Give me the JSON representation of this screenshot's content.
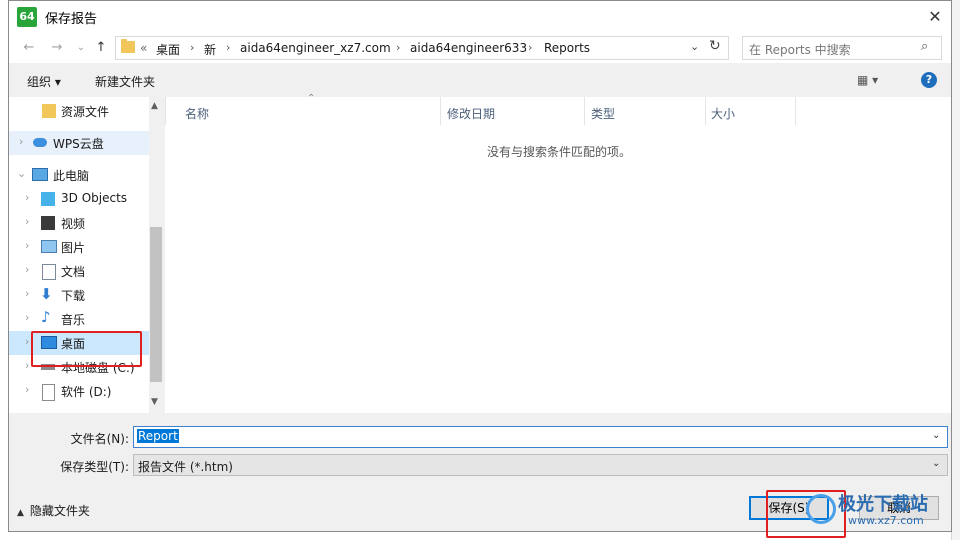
{
  "window": {
    "app_icon_text": "64",
    "title": "保存报告",
    "close_glyph": "✕"
  },
  "nav": {
    "back": "←",
    "forward": "→",
    "up": "↑"
  },
  "address": {
    "prefix": "«",
    "crumbs": [
      "桌面",
      "新",
      "aida64engineer_xz7.com",
      "aida64engineer633",
      "Reports"
    ],
    "separator": "›"
  },
  "search": {
    "placeholder": "在 Reports 中搜索"
  },
  "toolbar": {
    "organize": "组织 ▾",
    "new_folder": "新建文件夹",
    "view": "▦ ▾",
    "help": "?"
  },
  "sidebar": {
    "items": [
      {
        "label": "资源文件",
        "icon": "folder-icon"
      },
      {
        "label": "WPS云盘",
        "icon": "cloud-icon"
      },
      {
        "label": "此电脑",
        "icon": "computer-icon"
      },
      {
        "label": "3D Objects",
        "icon": "cube-icon"
      },
      {
        "label": "视频",
        "icon": "video-icon"
      },
      {
        "label": "图片",
        "icon": "picture-icon"
      },
      {
        "label": "文档",
        "icon": "document-icon"
      },
      {
        "label": "下载",
        "icon": "download-icon"
      },
      {
        "label": "音乐",
        "icon": "music-icon"
      },
      {
        "label": "桌面",
        "icon": "desktop-icon"
      },
      {
        "label": "本地磁盘 (C:)",
        "icon": "drive-icon"
      },
      {
        "label": "软件 (D:)",
        "icon": "drive-icon"
      }
    ],
    "selected": "桌面"
  },
  "filelist": {
    "columns": [
      "名称",
      "修改日期",
      "类型",
      "大小"
    ],
    "empty_message": "没有与搜索条件匹配的项。"
  },
  "form": {
    "filename_label": "文件名(N):",
    "filename_value": "Report",
    "filetype_label": "保存类型(T):",
    "filetype_value": "报告文件 (*.htm)"
  },
  "footer": {
    "hide_folders": "隐藏文件夹",
    "save": "保存(S)",
    "cancel": "取消"
  },
  "watermark": {
    "brand": "极光下载站",
    "url": "www.xz7.com"
  },
  "colors": {
    "accent": "#0078d7",
    "highlight_box": "#e02020",
    "selected_bg": "#cce8ff"
  }
}
